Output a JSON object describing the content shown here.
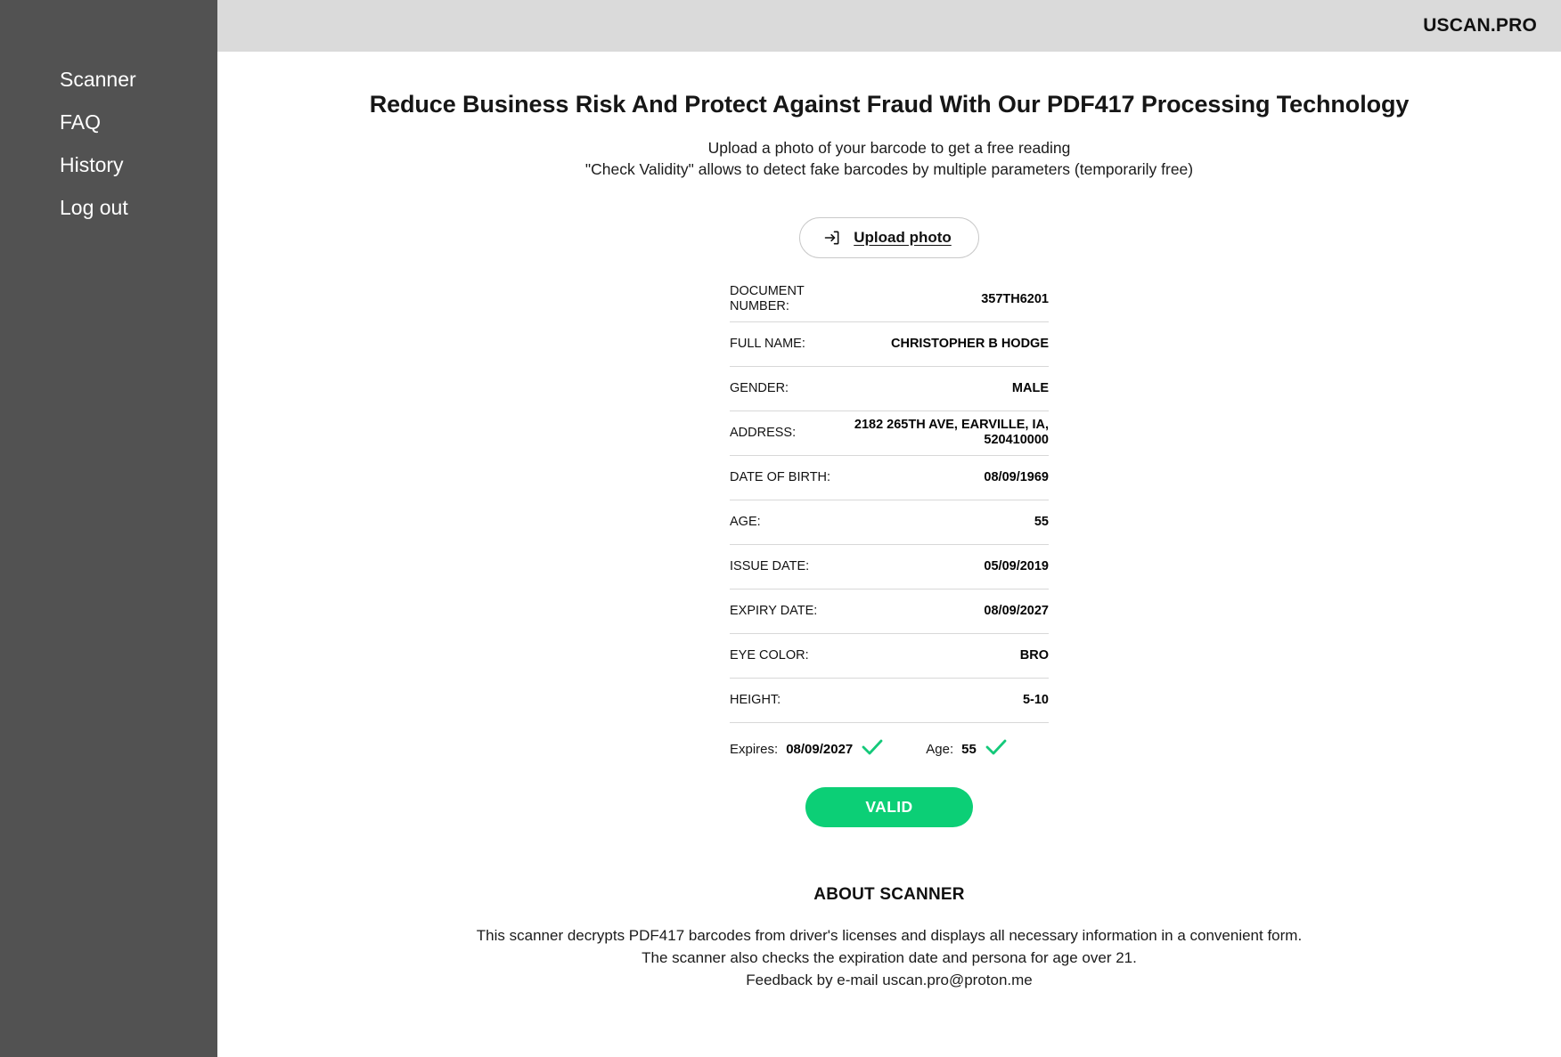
{
  "sidebar": {
    "items": [
      {
        "label": "Scanner",
        "name": "sidebar-item-scanner"
      },
      {
        "label": "FAQ",
        "name": "sidebar-item-faq"
      },
      {
        "label": "History",
        "name": "sidebar-item-history"
      },
      {
        "label": "Log out",
        "name": "sidebar-item-logout"
      }
    ],
    "background_color": "#525252"
  },
  "header": {
    "brand": "USCAN.PRO",
    "background_color": "#dadada"
  },
  "main": {
    "title": "Reduce Business Risk And Protect Against Fraud With Our PDF417 Processing Technology",
    "subtitle_line1": "Upload a photo of your barcode to get a free reading",
    "subtitle_line2": "\"Check Validity\" allows to detect fake barcodes by multiple parameters (temporarily free)",
    "upload_button": {
      "label": "Upload photo",
      "icon": "upload-arrow-into-box-icon"
    },
    "record": {
      "rows": [
        {
          "key": "DOCUMENT\nNUMBER:",
          "value": "357TH6201",
          "name": "document-number"
        },
        {
          "key": "FULL NAME:",
          "value": "CHRISTOPHER B HODGE",
          "name": "full-name"
        },
        {
          "key": "GENDER:",
          "value": "MALE",
          "name": "gender"
        },
        {
          "key": "ADDRESS:",
          "value": "2182 265TH AVE, EARVILLE, IA, 520410000",
          "name": "address"
        },
        {
          "key": "DATE OF BIRTH:",
          "value": "08/09/1969",
          "name": "date-of-birth"
        },
        {
          "key": "AGE:",
          "value": "55",
          "name": "age"
        },
        {
          "key": "ISSUE DATE:",
          "value": "05/09/2019",
          "name": "issue-date"
        },
        {
          "key": "EXPIRY DATE:",
          "value": "08/09/2027",
          "name": "expiry-date"
        },
        {
          "key": "EYE COLOR:",
          "value": "BRO",
          "name": "eye-color"
        },
        {
          "key": "HEIGHT:",
          "value": "5-10",
          "name": "height"
        }
      ]
    },
    "checks": {
      "expires_label": "Expires:",
      "expires_value": "08/09/2027",
      "age_label": "Age:",
      "age_value": "55",
      "check_icon": "green-checkmark-icon",
      "check_color": "#0ccf76"
    },
    "status_button": {
      "label": "VALID",
      "color": "#0ccf76"
    },
    "about": {
      "title": "ABOUT SCANNER",
      "line1": "This scanner decrypts PDF417 barcodes from driver's licenses and displays all necessary information in a convenient form.",
      "line2": "The scanner also checks the expiration date and persona for age over 21.",
      "line3": "Feedback by e-mail uscan.pro@proton.me"
    }
  }
}
